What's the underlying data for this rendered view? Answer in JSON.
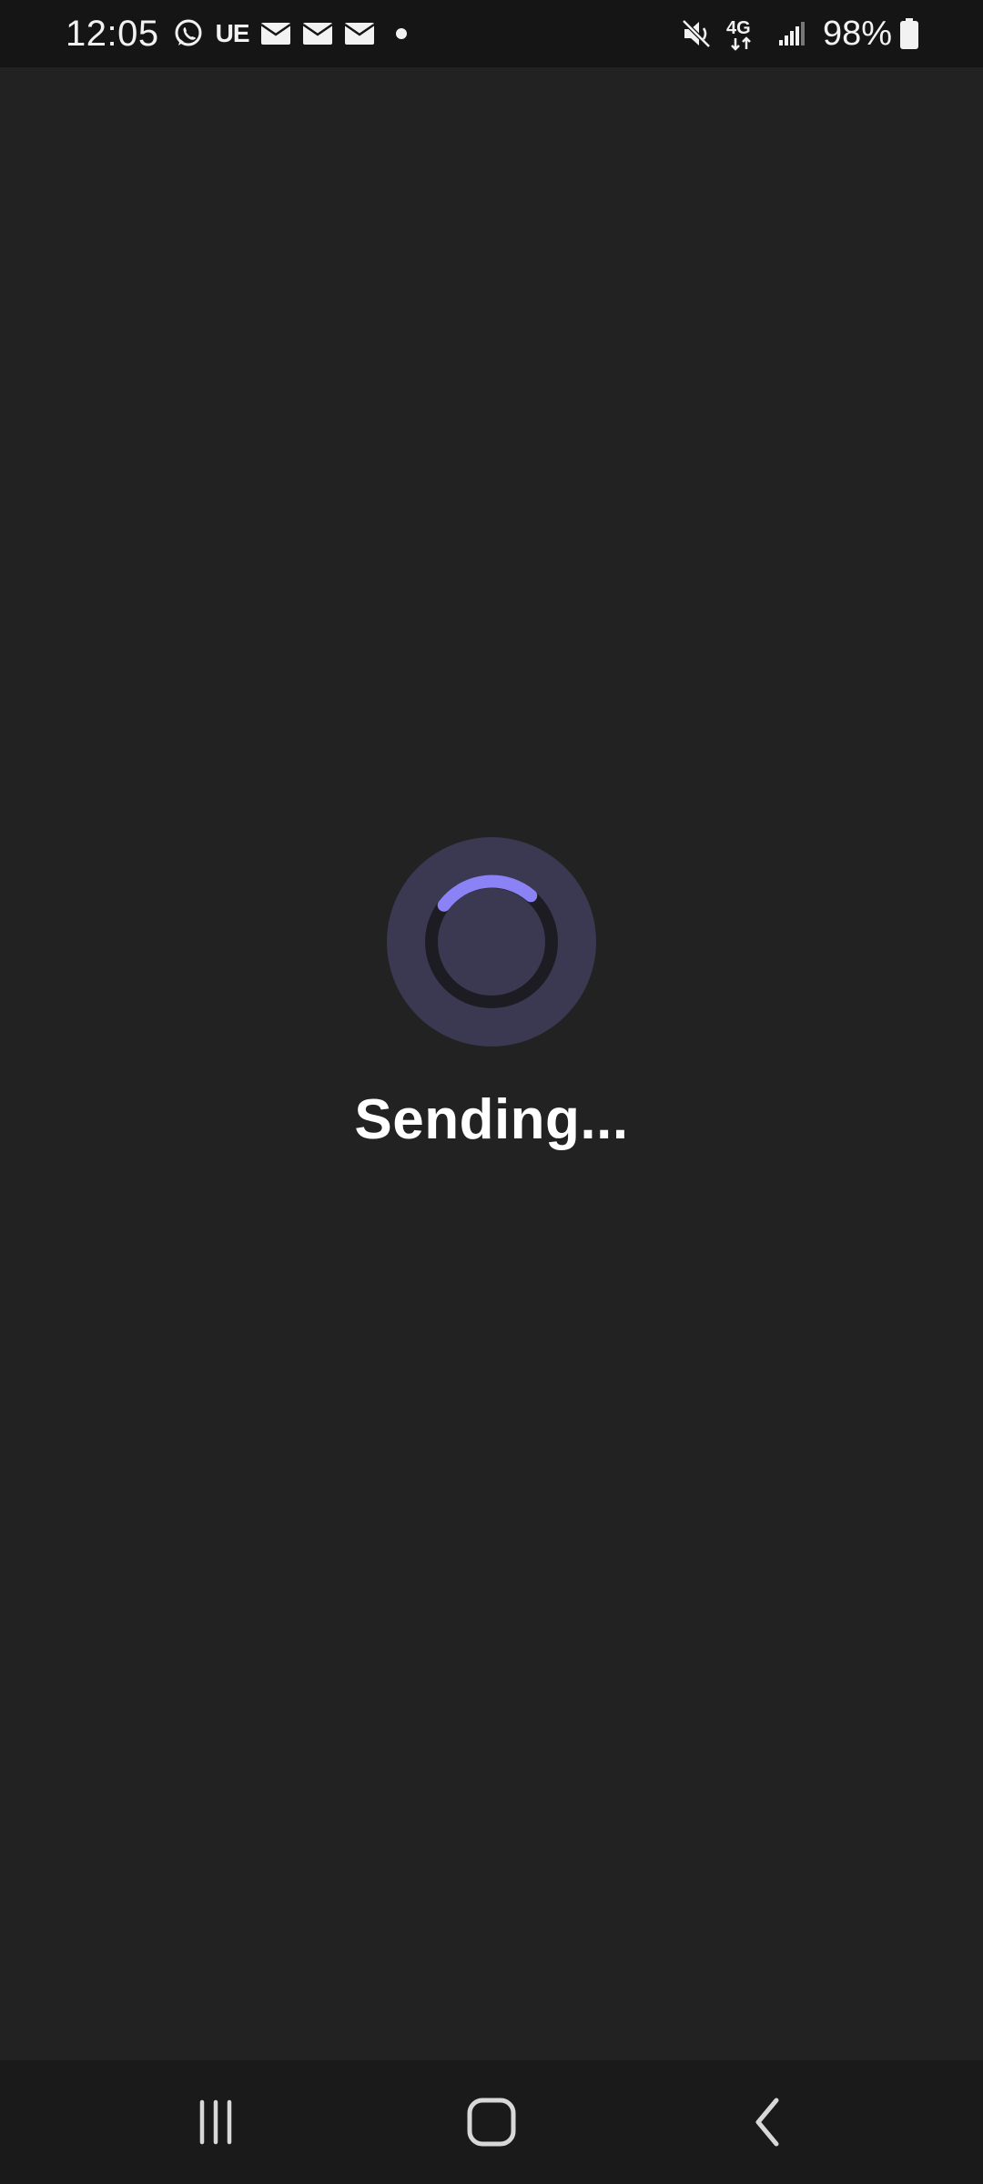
{
  "status_bar": {
    "time": "12:05",
    "carrier_badge": "UE",
    "battery_percent": "98%",
    "network_type": "4G",
    "icons": [
      "whatsapp-icon",
      "ue-icon",
      "mail-icon",
      "mail-icon",
      "mail-icon",
      "dot-icon",
      "mute-icon",
      "network-4g-icon",
      "signal-icon",
      "battery-icon"
    ]
  },
  "main": {
    "status_text": "Sending...",
    "spinner_icon": "loading-spinner-icon",
    "accent_color": "#8b82f5",
    "spinner_bg_color": "#3b3851"
  },
  "nav_bar": {
    "buttons": [
      "recent-apps-icon",
      "home-icon",
      "back-icon"
    ]
  }
}
